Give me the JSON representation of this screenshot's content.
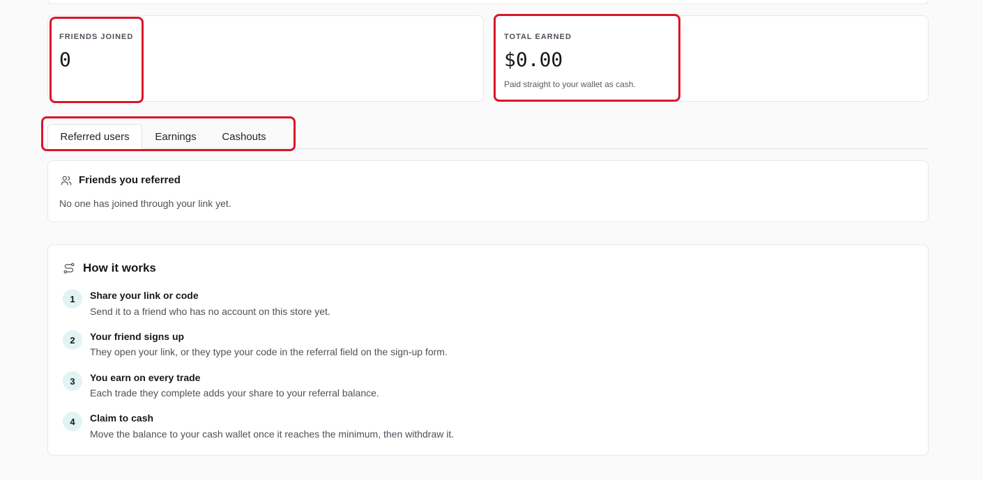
{
  "stats": {
    "friends_joined": {
      "label": "FRIENDS JOINED",
      "value": "0"
    },
    "total_earned": {
      "label": "TOTAL EARNED",
      "value": "$0.00",
      "note": "Paid straight to your wallet as cash."
    }
  },
  "tabs": [
    {
      "label": "Referred users",
      "active": true
    },
    {
      "label": "Earnings",
      "active": false
    },
    {
      "label": "Cashouts",
      "active": false
    }
  ],
  "referred": {
    "title": "Friends you referred",
    "empty_text": "No one has joined through your link yet.",
    "icon": "users-icon"
  },
  "how_it_works": {
    "title": "How it works",
    "icon": "route-icon",
    "steps": [
      {
        "num": "1",
        "title": "Share your link or code",
        "desc": "Send it to a friend who has no account on this store yet."
      },
      {
        "num": "2",
        "title": "Your friend signs up",
        "desc": "They open your link, or they type your code in the referral field on the sign-up form."
      },
      {
        "num": "3",
        "title": "You earn on every trade",
        "desc": "Each trade they complete adds your share to your referral balance."
      },
      {
        "num": "4",
        "title": "Claim to cash",
        "desc": "Move the balance to your cash wallet once it reaches the minimum, then withdraw it."
      }
    ]
  },
  "colors": {
    "highlight": "#d9152a",
    "step_badge": "#e2f3f3"
  }
}
